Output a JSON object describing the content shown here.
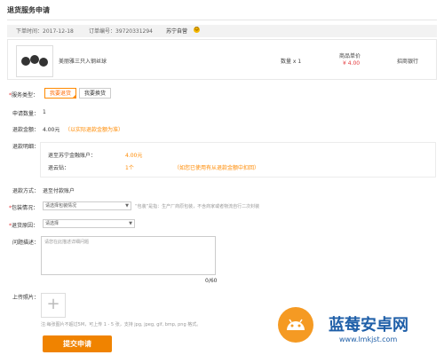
{
  "page": {
    "title": "退货服务申请"
  },
  "order": {
    "time": "下单时间：2017-12-18",
    "number": "订单编号：39720331294",
    "store": "苏宁自营",
    "store_icon": "smile-icon"
  },
  "product": {
    "name": "美丽雅三只入钢丝球",
    "quantity": "数量 x 1",
    "price_label": "商品单价",
    "price": "¥ 4.00",
    "bank": "招商银行"
  },
  "service_type": {
    "label": "服务类型：",
    "options": [
      "我要退货",
      "我要换货"
    ],
    "selected": "我要退货"
  },
  "apply_qty": {
    "label": "申请数量：",
    "value": "1"
  },
  "refund_amount": {
    "label": "退款金额：",
    "value": "4.00元",
    "note": "（以实际退款金额为准）"
  },
  "refund_detail": {
    "label": "退款明细：",
    "row1_label": "退至苏宁金融账户：",
    "row1_value": "4.00元",
    "row2_label": "退云钻：",
    "row2_value": "1个",
    "row2_note": "（如您已使用有从退款金额中扣回）"
  },
  "refund_method": {
    "label": "退款方式：",
    "value": "退至付款账户"
  },
  "package": {
    "label": "包装情况：",
    "placeholder": "请选择包装情况",
    "note": "“包装”是指：生产厂商原包装，不含商家或者物流自行二次封装"
  },
  "return_reason": {
    "label": "退货原因：",
    "placeholder": "请选择"
  },
  "issue": {
    "label": "问题描述：",
    "placeholder": "请您在此描述详细问题",
    "counter": "0/60"
  },
  "photos": {
    "label": "上传照片：",
    "add": "+",
    "note": "注:每张图片不超过5M，可上传 1 - 5 张，支持 jpg, jpeg, gif, bmp, png 格式。"
  },
  "submit": {
    "label": "提交申请"
  },
  "watermark": {
    "name": "蓝莓安卓网",
    "url": "www.lmkjst.com"
  },
  "colors": {
    "accent": "#f08300",
    "price": "#e4393c",
    "watermark": "#1f5fa8"
  }
}
